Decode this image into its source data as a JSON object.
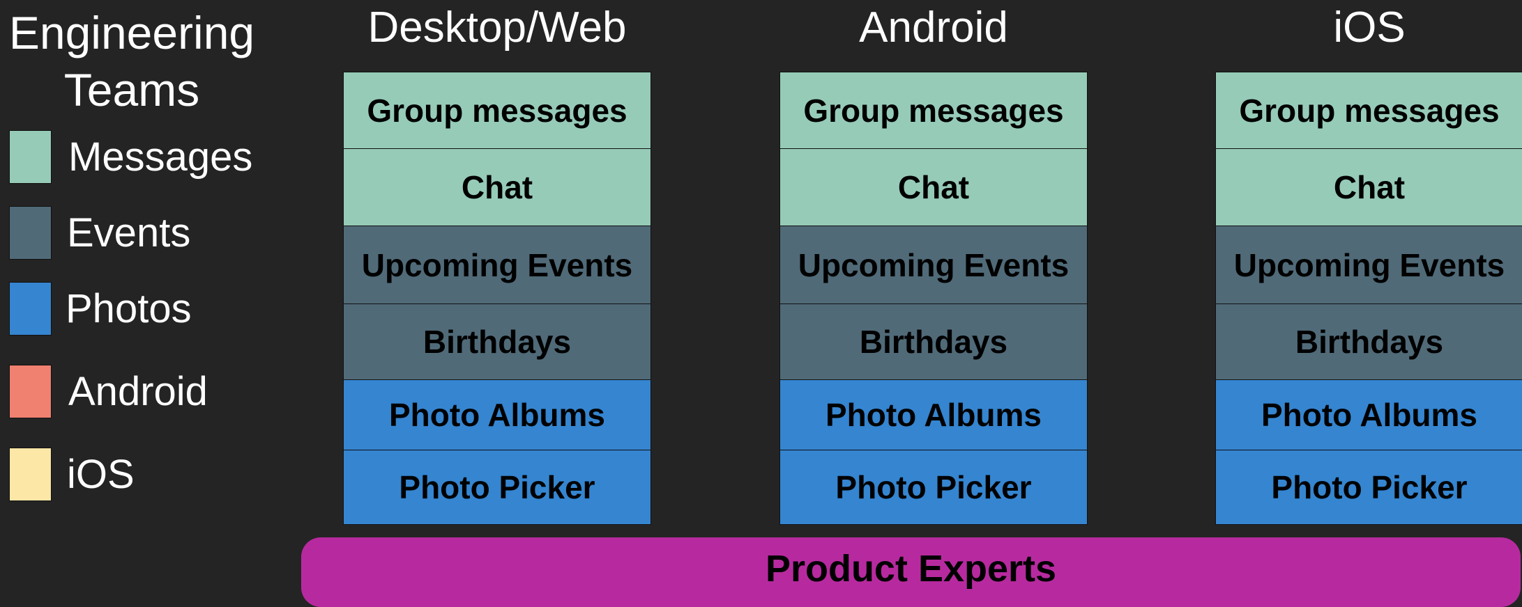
{
  "legend": {
    "title": "Engineering\nTeams",
    "items": [
      {
        "label": "Messages",
        "color": "#96cbb8"
      },
      {
        "label": "Events",
        "color": "#506a78"
      },
      {
        "label": "Photos",
        "color": "#3585d0"
      },
      {
        "label": "Android",
        "color": "#f08070"
      },
      {
        "label": "iOS",
        "color": "#fde7a6"
      }
    ]
  },
  "columns": [
    {
      "title": "Desktop/Web",
      "cells": [
        {
          "label": "Group messages",
          "team": "Messages"
        },
        {
          "label": "Chat",
          "team": "Messages"
        },
        {
          "label": "Upcoming Events",
          "team": "Events"
        },
        {
          "label": "Birthdays",
          "team": "Events"
        },
        {
          "label": "Photo Albums",
          "team": "Photos"
        },
        {
          "label": "Photo Picker",
          "team": "Photos"
        }
      ]
    },
    {
      "title": "Android",
      "cells": [
        {
          "label": "Group messages",
          "team": "Messages"
        },
        {
          "label": "Chat",
          "team": "Messages"
        },
        {
          "label": "Upcoming Events",
          "team": "Events"
        },
        {
          "label": "Birthdays",
          "team": "Events"
        },
        {
          "label": "Photo Albums",
          "team": "Photos"
        },
        {
          "label": "Photo Picker",
          "team": "Photos"
        }
      ]
    },
    {
      "title": "iOS",
      "cells": [
        {
          "label": "Group messages",
          "team": "Messages"
        },
        {
          "label": "Chat",
          "team": "Messages"
        },
        {
          "label": "Upcoming Events",
          "team": "Events"
        },
        {
          "label": "Birthdays",
          "team": "Events"
        },
        {
          "label": "Photo Albums",
          "team": "Photos"
        },
        {
          "label": "Photo Picker",
          "team": "Photos"
        }
      ]
    }
  ],
  "footer": {
    "label": "Product Experts",
    "color": "#b72a9f"
  }
}
